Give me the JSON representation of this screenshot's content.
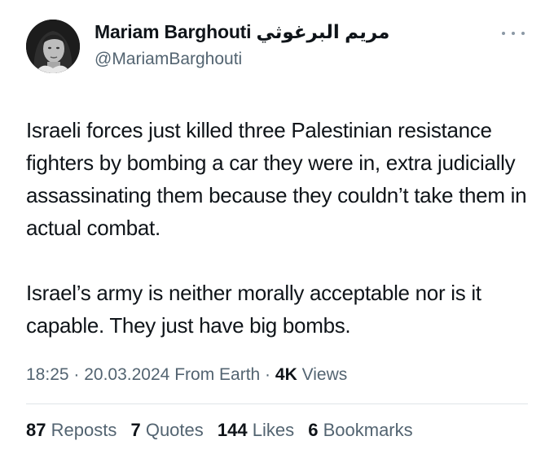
{
  "author": {
    "display_name": "Mariam Barghouti مريم البرغوثي",
    "handle": "@MariamBarghouti",
    "avatar_icon": "profile-photo"
  },
  "menu": {
    "icon": "more-dots-icon"
  },
  "tweet": {
    "paragraphs": [
      "Israeli forces just killed three Palestinian resistance fighters by bombing a car they were in, extra judicially assassinating them because they couldn’t take them in actual combat.",
      "Israel’s army is neither morally acceptable nor is it capable. They just have big bombs."
    ]
  },
  "meta": {
    "time": "18:25",
    "date": "20.03.2024",
    "source": "From Earth",
    "views_count": "4K",
    "views_label": "Views"
  },
  "stats": {
    "reposts_count": "87",
    "reposts_label": "Reposts",
    "quotes_count": "7",
    "quotes_label": "Quotes",
    "likes_count": "144",
    "likes_label": "Likes",
    "bookmarks_count": "6",
    "bookmarks_label": "Bookmarks"
  },
  "colors": {
    "text": "#0f1419",
    "secondary": "#536471",
    "divider": "#dfe4e8"
  }
}
